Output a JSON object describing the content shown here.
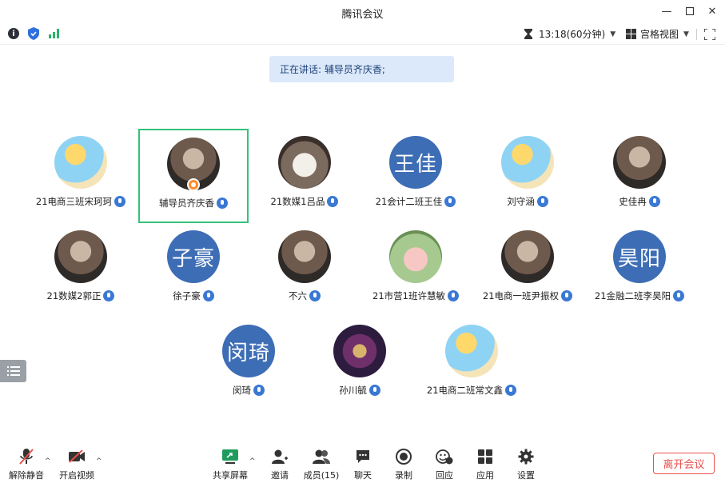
{
  "window": {
    "title": "腾讯会议"
  },
  "topbar": {
    "timer": "13:18(60分钟)",
    "view_mode": "宫格视图"
  },
  "speaking": {
    "text": "正在讲话: 辅导员齐庆香;"
  },
  "participants": [
    {
      "name": "21电商三班宋珂珂",
      "avatar": "cartoon-avatar",
      "avatar_text": ""
    },
    {
      "name": "辅导员齐庆香",
      "avatar": "photo-avatar",
      "avatar_text": "",
      "active": true
    },
    {
      "name": "21数媒1吕品",
      "avatar": "cat-avatar",
      "avatar_text": ""
    },
    {
      "name": "21会计二班王佳",
      "avatar": "text-avatar",
      "avatar_text": "王佳"
    },
    {
      "name": "刘守涵",
      "avatar": "cartoon-avatar",
      "avatar_text": ""
    },
    {
      "name": "史佳冉",
      "avatar": "photo-avatar",
      "avatar_text": ""
    },
    {
      "name": "21数媒2郭正",
      "avatar": "photo-avatar",
      "avatar_text": ""
    },
    {
      "name": "徐子豪",
      "avatar": "text-avatar",
      "avatar_text": "子豪"
    },
    {
      "name": "不六",
      "avatar": "photo-avatar",
      "avatar_text": ""
    },
    {
      "name": "21市营1班许慧敏",
      "avatar": "pig-avatar",
      "avatar_text": ""
    },
    {
      "name": "21电商一班尹振权",
      "avatar": "photo-avatar",
      "avatar_text": ""
    },
    {
      "name": "21金融二班李昊阳",
      "avatar": "text-avatar",
      "avatar_text": "昊阳"
    },
    {
      "name": "闵琦",
      "avatar": "text-avatar",
      "avatar_text": "闵琦"
    },
    {
      "name": "孙川毓",
      "avatar": "art-avatar",
      "avatar_text": ""
    },
    {
      "name": "21电商二班常文鑫",
      "avatar": "cartoon-avatar",
      "avatar_text": ""
    }
  ],
  "bottombar": {
    "unmute": "解除静音",
    "start_video": "开启视频",
    "share_screen": "共享屏幕",
    "invite": "邀请",
    "members": "成员(15)",
    "chat": "聊天",
    "record": "录制",
    "reactions": "回应",
    "apps": "应用",
    "settings": "设置",
    "leave": "离开会议"
  },
  "colors": {
    "accent": "#3d6db5",
    "active_border": "#33c27a",
    "leave": "#e8504b",
    "banner": "#dce9fa"
  }
}
